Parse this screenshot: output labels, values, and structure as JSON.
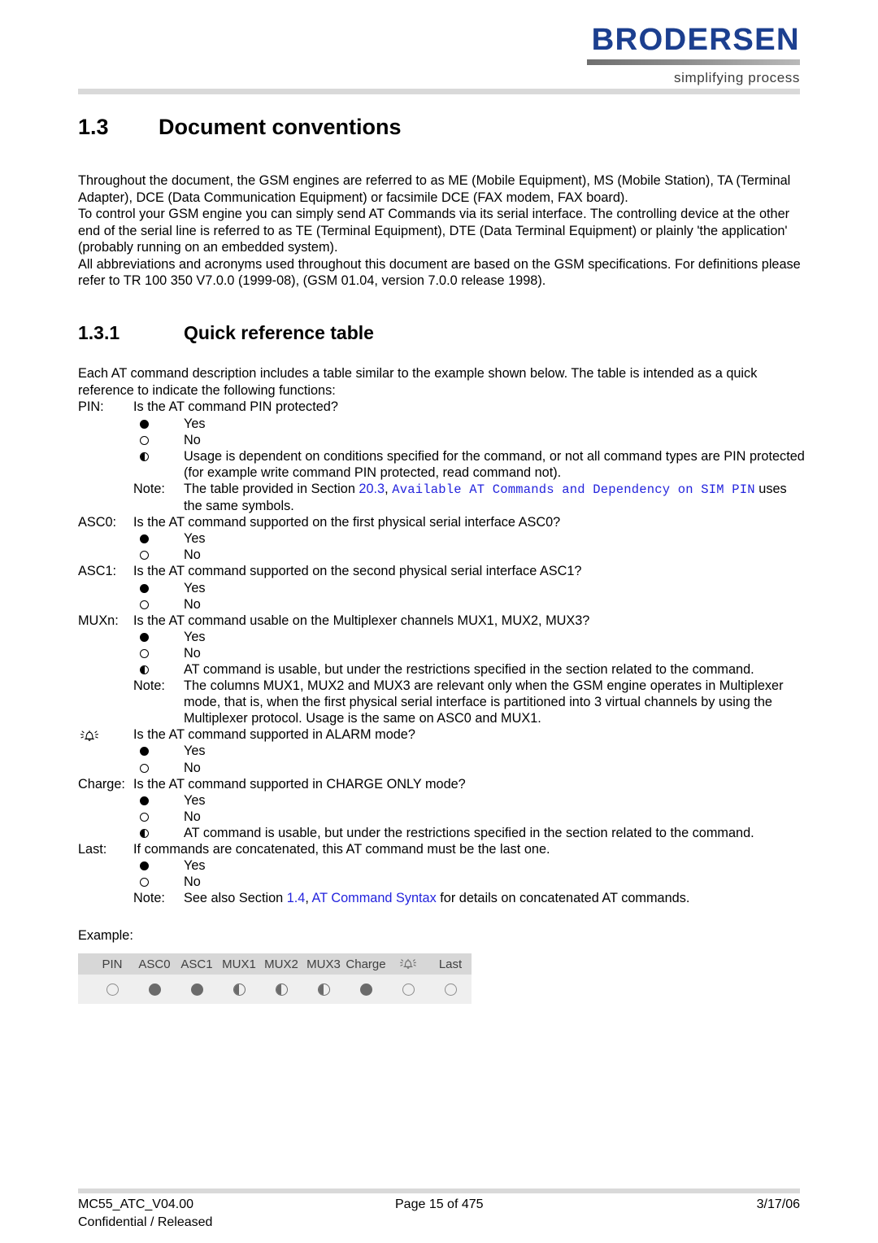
{
  "header": {
    "logo_word": "BRODERSEN",
    "logo_tagline": "simplifying process"
  },
  "section": {
    "number": "1.3",
    "title": "Document conventions",
    "paragraphs": [
      "Throughout the document, the GSM engines are referred to as ME (Mobile Equipment), MS (Mobile Station), TA (Terminal Adapter), DCE (Data Communication Equipment) or facsimile DCE (FAX modem, FAX board).",
      "To control your GSM engine you can simply send AT Commands via its serial interface. The controlling device at the other end of the serial line is referred to as TE (Terminal Equipment), DTE (Data Terminal Equipment) or plainly 'the application' (probably running on an embedded system).",
      "All abbreviations and acronyms used throughout this document are based on the GSM specifications. For definitions please refer to TR 100 350 V7.0.0 (1999-08), (GSM 01.04, version 7.0.0 release 1998)."
    ]
  },
  "subsection": {
    "number": "1.3.1",
    "title": "Quick reference table",
    "intro": "Each AT command description includes a table similar to the example shown below. The table is intended as a quick reference to indicate the following functions:"
  },
  "definitions": {
    "pin": {
      "term": "PIN:",
      "question": "Is the AT command PIN protected?",
      "yes": "Yes",
      "no": "No",
      "half": "Usage is dependent on conditions specified for the command, or not all command types are PIN protected (for example write command PIN protected, read command not).",
      "note_label": "Note:",
      "note_pre": "The table provided in Section ",
      "note_link_num": "20.3",
      "note_sep": ", ",
      "note_link_mono": "Available AT Commands and Dependency on SIM PIN",
      "note_post": " uses the same symbols."
    },
    "asc0": {
      "term": "ASC0:",
      "question": "Is the AT command supported on the first physical serial interface ASC0?",
      "yes": "Yes",
      "no": "No"
    },
    "asc1": {
      "term": "ASC1:",
      "question": "Is the AT command supported on the second physical serial interface ASC1?",
      "yes": "Yes",
      "no": "No"
    },
    "muxn": {
      "term": "MUXn:",
      "question": "Is the AT command usable on the Multiplexer channels MUX1, MUX2, MUX3?",
      "yes": "Yes",
      "no": "No",
      "half": "AT command is usable, but under the restrictions specified in the section related to the command.",
      "note_label": "Note:",
      "note_text": "The columns MUX1, MUX2 and MUX3 are relevant only when the GSM engine operates in Multiplexer mode, that is, when the first physical serial interface is partitioned into 3 virtual channels by using the Multiplexer protocol. Usage is the same on ASC0 and MUX1."
    },
    "alarm": {
      "icon": "alarm-bell-icon",
      "question": "Is the AT command supported in ALARM mode?",
      "yes": "Yes",
      "no": "No"
    },
    "charge": {
      "term": "Charge:",
      "question": "Is the AT command supported in CHARGE ONLY mode?",
      "yes": "Yes",
      "no": "No",
      "half": "AT command is usable, but under the restrictions specified in the section related to the command."
    },
    "last": {
      "term": "Last:",
      "question": "If commands are concatenated, this AT command must be the last one.",
      "yes": "Yes",
      "no": "No",
      "note_label": "Note:",
      "note_pre": "See also Section ",
      "note_link_num": "1.4",
      "note_sep": ", ",
      "note_link_title": "AT Command Syntax",
      "note_post": " for details on concatenated AT commands."
    }
  },
  "example": {
    "label": "Example:",
    "columns": [
      "PIN",
      "ASC0",
      "ASC1",
      "MUX1",
      "MUX2",
      "MUX3",
      "Charge",
      "alarm-bell-icon",
      "Last"
    ],
    "values": [
      "empty",
      "filled",
      "filled",
      "half",
      "half",
      "half",
      "filled",
      "empty",
      "empty"
    ],
    "header_bg": "#d7d7d7",
    "body_bg": "#efefef",
    "dot_color": "#6b6b6b"
  },
  "footer": {
    "doc_id": "MC55_ATC_V04.00",
    "confidentiality": "Confidential / Released",
    "page": "Page 15 of 475",
    "date": "3/17/06"
  },
  "colors": {
    "link_blue": "#2323dd",
    "logo_blue": "#1c3f8f",
    "rule_gray": "#d9d9d9"
  }
}
